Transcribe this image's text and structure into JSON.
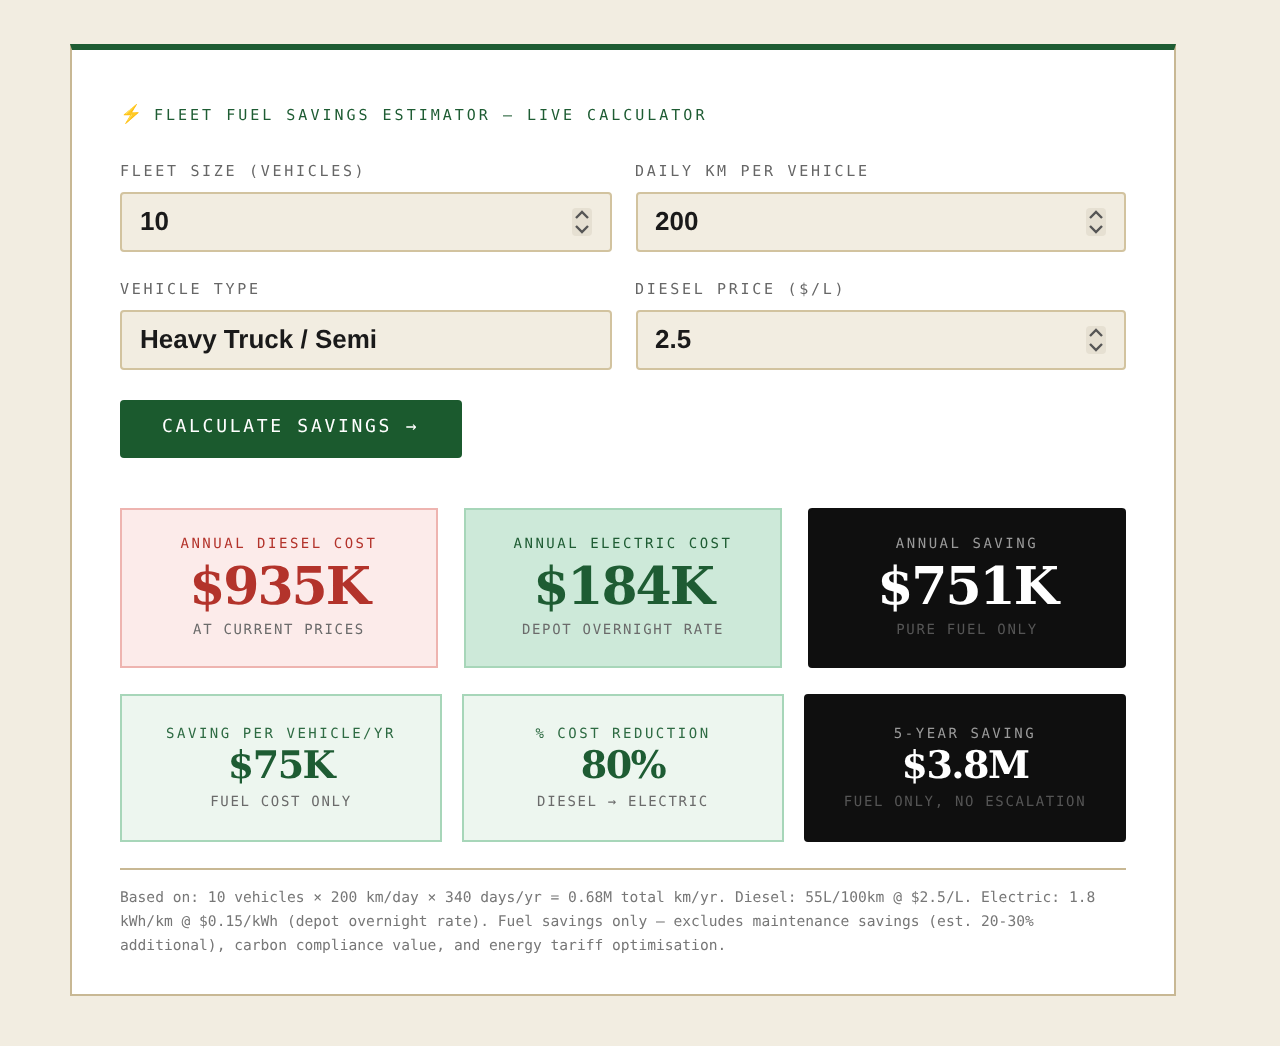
{
  "header": {
    "icon": "⚡",
    "title": "FLEET FUEL SAVINGS ESTIMATOR — LIVE CALCULATOR"
  },
  "fields": [
    {
      "label": "FLEET SIZE (VEHICLES)",
      "value": "10",
      "kind": "number"
    },
    {
      "label": "DAILY KM PER VEHICLE",
      "value": "200",
      "kind": "number"
    },
    {
      "label": "VEHICLE TYPE",
      "value": "Heavy Truck / Semi",
      "kind": "select"
    },
    {
      "label": "DIESEL PRICE ($/L)",
      "value": "2.5",
      "kind": "number"
    }
  ],
  "button": "CALCULATE SAVINGS →",
  "results": [
    {
      "kind": "diesel",
      "label": "ANNUAL DIESEL COST",
      "value": "$935K",
      "note": "AT CURRENT PRICES"
    },
    {
      "kind": "electric",
      "label": "ANNUAL ELECTRIC COST",
      "value": "$184K",
      "note": "DEPOT OVERNIGHT RATE"
    },
    {
      "kind": "dark",
      "label": "ANNUAL SAVING",
      "value": "$751K",
      "note": "PURE FUEL ONLY"
    }
  ],
  "results_secondary": [
    {
      "kind": "light",
      "label": "SAVING PER VEHICLE/YR",
      "value": "$75K",
      "note": "FUEL COST ONLY"
    },
    {
      "kind": "light",
      "label": "% COST REDUCTION",
      "value": "80%",
      "note": "DIESEL → ELECTRIC"
    },
    {
      "kind": "dark",
      "label": "5-YEAR SAVING",
      "value": "$3.8M",
      "note": "FUEL ONLY, NO ESCALATION"
    }
  ],
  "footnote": "Based on: 10 vehicles × 200 km/day × 340 days/yr = 0.68M total km/yr. Diesel: 55L/100km @ $2.5/L. Electric: 1.8 kWh/km @ $0.15/kWh (depot overnight rate). Fuel savings only — excludes maintenance savings (est. 20-30% additional), carbon compliance value, and energy tariff optimisation."
}
